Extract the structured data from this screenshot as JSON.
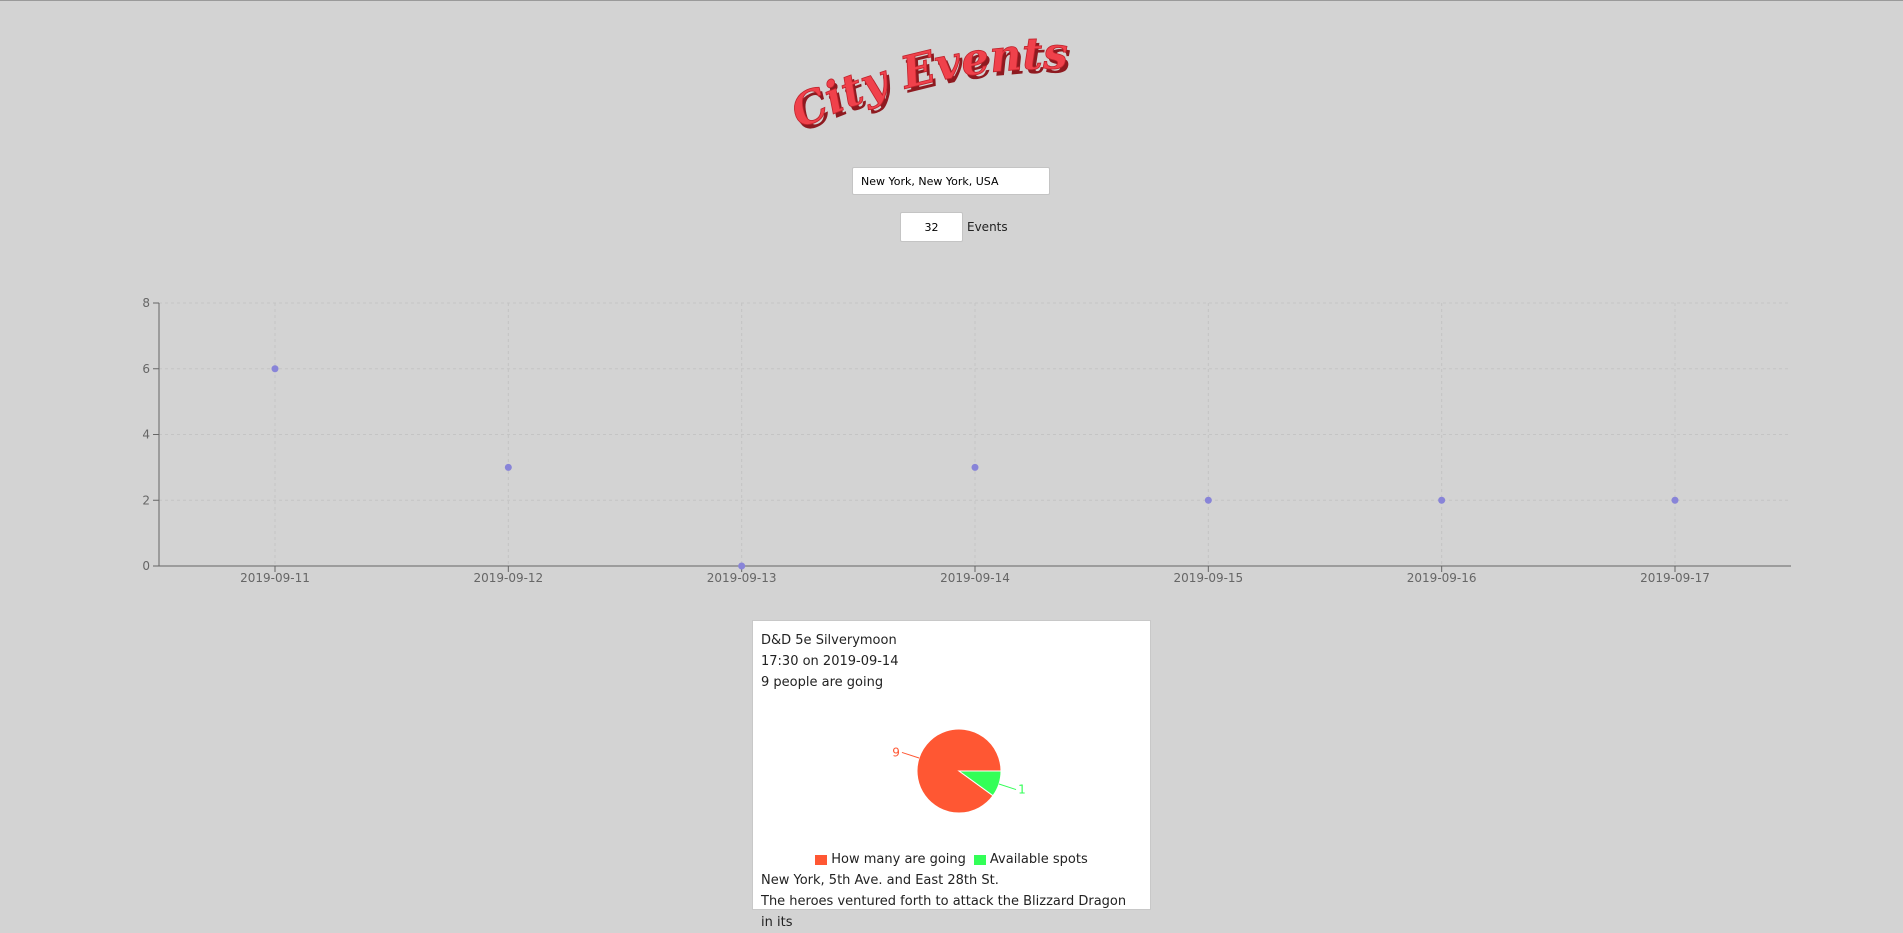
{
  "app": {
    "logo_text": "City Events"
  },
  "search": {
    "city_value": "New York, New York, USA",
    "count_value": "32",
    "count_label": "Events"
  },
  "colors": {
    "background": "#d3d3d3",
    "logo_red": "#f0414b",
    "scatter_point": "#8884d8",
    "going": "#ff5733",
    "available": "#33ff57"
  },
  "chart_data": {
    "type": "scatter",
    "x": [
      "2019-09-11",
      "2019-09-12",
      "2019-09-13",
      "2019-09-14",
      "2019-09-15",
      "2019-09-16",
      "2019-09-17"
    ],
    "y": [
      6,
      3,
      0,
      3,
      2,
      2,
      2
    ],
    "y_ticks": [
      "0",
      "2",
      "4",
      "6",
      "8"
    ],
    "ylim": [
      0,
      8
    ],
    "grid": true
  },
  "event_card": {
    "title": "D&D 5e Silverymoon",
    "time": "17:30 on 2019-09-14",
    "going_text": "9 people are going",
    "pie": {
      "type": "pie",
      "slices": [
        {
          "name": "How many are going",
          "value": 9,
          "label": "9",
          "color": "#ff5733"
        },
        {
          "name": "Available spots",
          "value": 1,
          "label": "1",
          "color": "#33ff57"
        }
      ]
    },
    "legend": [
      "How many are going",
      "Available spots"
    ],
    "location": "New York, 5th Ave. and East 28th St.",
    "description": "The heroes ventured forth to attack the Blizzard Dragon in its"
  }
}
